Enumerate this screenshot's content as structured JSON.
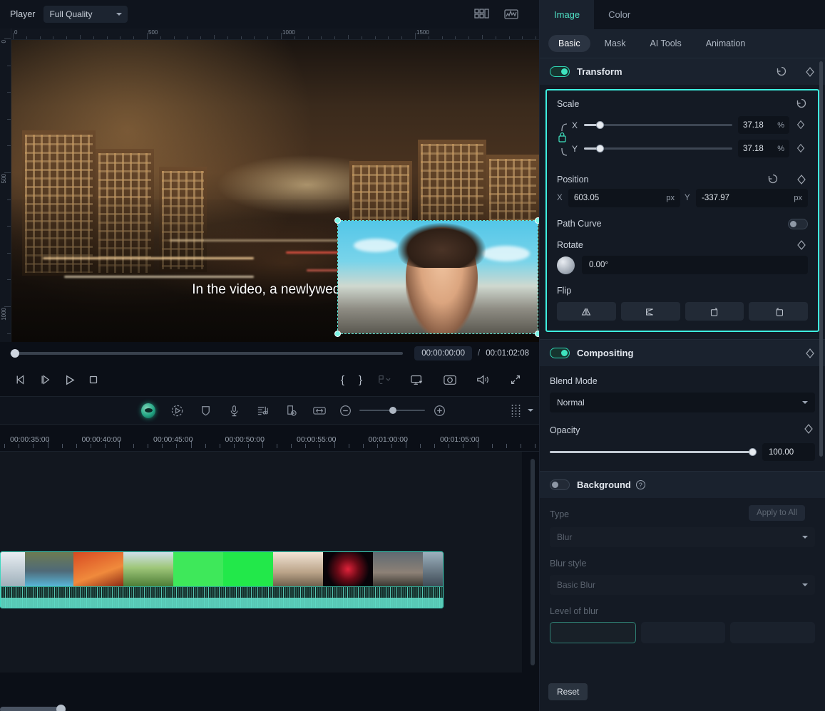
{
  "player": {
    "label": "Player",
    "quality": "Full Quality",
    "icons": {
      "layout": "layout-grid-icon",
      "scope": "waveform-scope-icon"
    },
    "ruler_h": {
      "labels": [
        "0",
        "500",
        "1000",
        "1500"
      ]
    },
    "ruler_v": {
      "labels": [
        "0",
        "500",
        "1000"
      ]
    },
    "subtitle": "In the video, a newlywed co",
    "current_time": "00:00:00:00",
    "separator": "/",
    "total_time": "00:01:02:08",
    "transport": {
      "prev_frame": "step-backward-button",
      "next_frame": "step-forward-button",
      "play": "play-button",
      "stop": "stop-button",
      "mark_in": "{",
      "mark_out": "}"
    }
  },
  "timeline": {
    "toolbar_icons": [
      "ai-assistant-icon",
      "record-voiceover-icon",
      "mask-shield-icon",
      "microphone-icon",
      "audio-mixer-icon",
      "crop-detect-icon",
      "fit-width-icon"
    ],
    "zoom_out": "−",
    "zoom_in": "+",
    "grid_icon": "timeline-grid-icon",
    "ruler_labels": [
      "00:00:35:00",
      "00:00:40:00",
      "00:00:45:00",
      "00:00:50:00",
      "00:00:55:00",
      "00:01:00:00",
      "00:01:05:00"
    ]
  },
  "panel": {
    "tabs": [
      {
        "label": "Image",
        "active": true
      },
      {
        "label": "Color",
        "active": false
      }
    ],
    "subtabs": [
      {
        "label": "Basic",
        "active": true
      },
      {
        "label": "Mask",
        "active": false
      },
      {
        "label": "AI Tools",
        "active": false
      },
      {
        "label": "Animation",
        "active": false
      }
    ],
    "transform": {
      "title": "Transform",
      "enabled": true,
      "scale": {
        "label": "Scale",
        "x_axis": "X",
        "y_axis": "Y",
        "x_value": "37.18",
        "y_value": "37.18",
        "unit": "%",
        "locked": true
      },
      "position": {
        "label": "Position",
        "x_axis": "X",
        "y_axis": "Y",
        "x_value": "603.05",
        "y_value": "-337.97",
        "unit": "px"
      },
      "path_curve": {
        "label": "Path Curve",
        "enabled": false
      },
      "rotate": {
        "label": "Rotate",
        "value": "0.00°"
      },
      "flip": {
        "label": "Flip",
        "buttons": [
          "flip-horizontal",
          "flip-vertical",
          "rotate-cw",
          "rotate-ccw"
        ]
      }
    },
    "compositing": {
      "title": "Compositing",
      "enabled": true,
      "blend_mode_label": "Blend Mode",
      "blend_mode_value": "Normal",
      "opacity_label": "Opacity",
      "opacity_value": "100.00"
    },
    "background": {
      "title": "Background",
      "enabled": false,
      "type_label": "Type",
      "type_value": "Blur",
      "apply_to_all": "Apply to All",
      "blur_style_label": "Blur style",
      "blur_style_value": "Basic Blur",
      "level_label": "Level of blur"
    },
    "reset_label": "Reset",
    "accent_color": "#3ef0e0",
    "toggle_on_color": "#3fe3bf"
  }
}
